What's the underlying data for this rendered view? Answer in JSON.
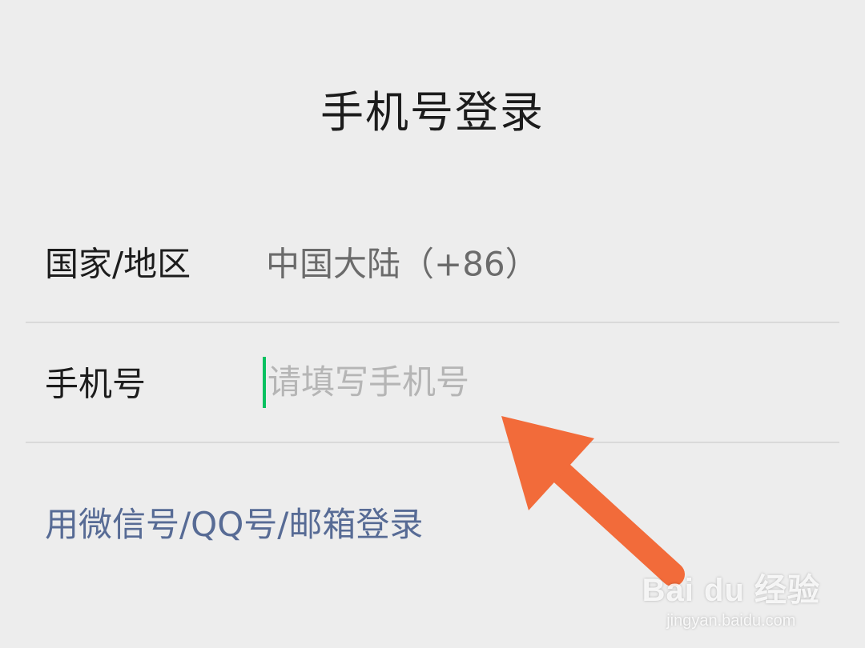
{
  "header": {
    "title": "手机号登录"
  },
  "form": {
    "region": {
      "label": "国家/地区",
      "value": "中国大陆（+86）"
    },
    "phone": {
      "label": "手机号",
      "placeholder": "请填写手机号",
      "value": ""
    }
  },
  "alt_login": {
    "label": "用微信号/QQ号/邮箱登录"
  },
  "annotation": {
    "icon": "arrow-icon",
    "color": "#f26b3a"
  },
  "watermark": {
    "brand": "Bai du 经验",
    "url": "jingyan.baidu.com"
  },
  "colors": {
    "background": "#ededed",
    "link": "#576b95",
    "caret": "#07c160"
  }
}
